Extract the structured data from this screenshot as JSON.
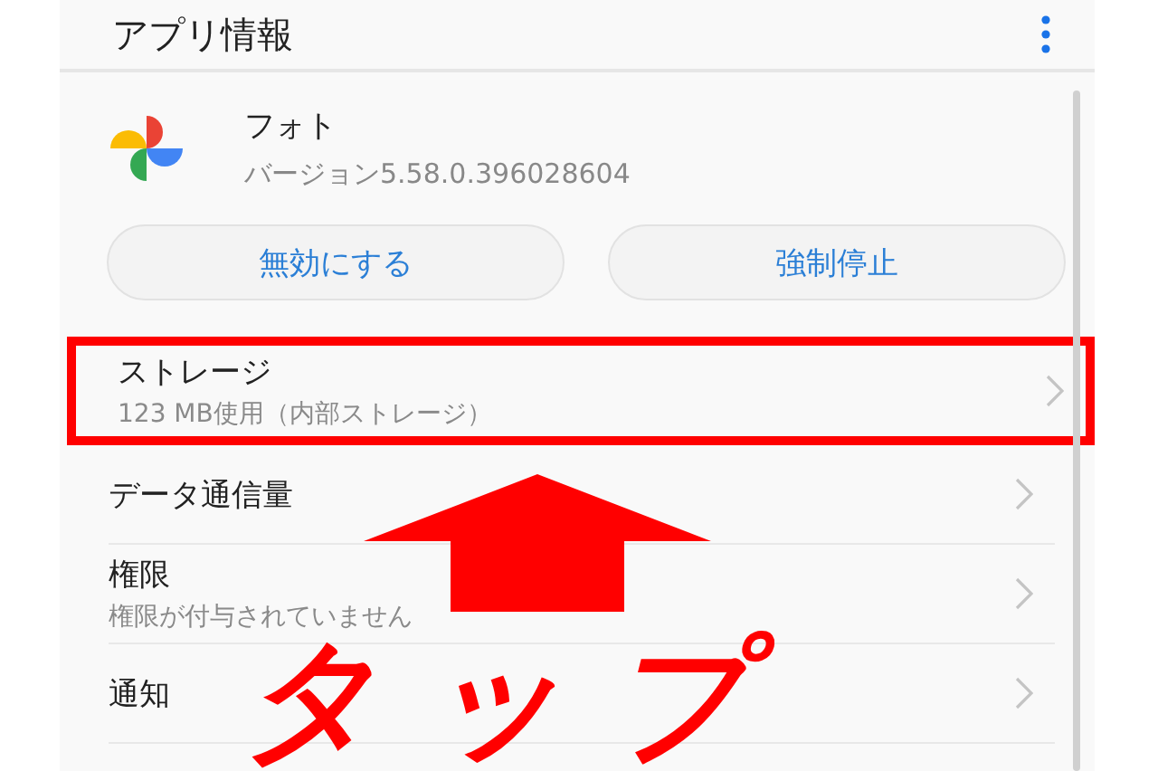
{
  "header": {
    "title": "アプリ情報"
  },
  "app": {
    "name": "フォト",
    "version": "バージョン5.58.0.396028604"
  },
  "buttons": [
    "無効にする",
    "強制停止"
  ],
  "rows": [
    {
      "title": "ストレージ",
      "subtitle": "123 MB使用（内部ストレージ）",
      "highlighted": true
    },
    {
      "title": "データ通信量",
      "highlighted": false
    },
    {
      "title": "権限",
      "subtitle": "権限が付与されていません",
      "highlighted": false
    },
    {
      "title": "通知",
      "highlighted": false
    }
  ],
  "annotation": {
    "text": "タップ"
  }
}
